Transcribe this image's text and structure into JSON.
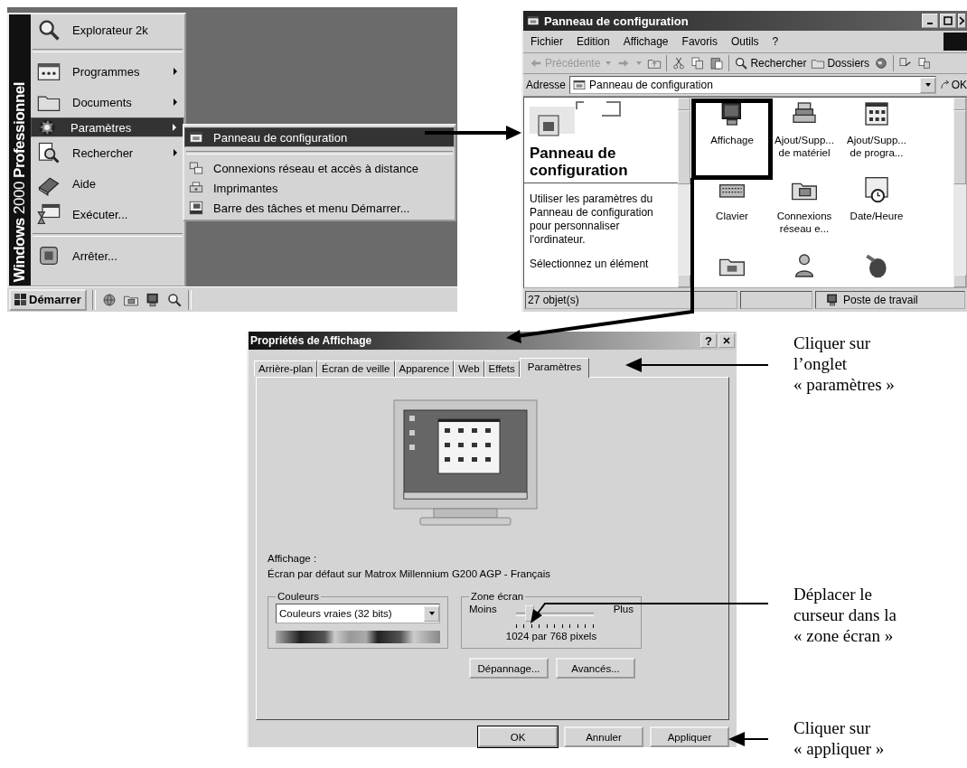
{
  "start_menu": {
    "banner": "**Windows** 2000 **Professionnel**",
    "groups": [
      [
        {
          "label": "Explorateur 2k",
          "has_submenu": false,
          "selected": false
        }
      ],
      [
        {
          "label": "Programmes",
          "has_submenu": true,
          "selected": false
        },
        {
          "label": "Documents",
          "has_submenu": true,
          "selected": false
        },
        {
          "label": "Paramètres",
          "has_submenu": true,
          "selected": true
        },
        {
          "label": "Rechercher",
          "has_submenu": true,
          "selected": false
        },
        {
          "label": "Aide",
          "has_submenu": false,
          "selected": false
        },
        {
          "label": "Exécuter...",
          "has_submenu": false,
          "selected": false
        }
      ],
      [
        {
          "label": "Arrêter...",
          "has_submenu": false,
          "selected": false
        }
      ]
    ],
    "submenu": {
      "groups": [
        [
          {
            "label": "Panneau de configuration",
            "selected": true
          }
        ],
        [
          {
            "label": "Connexions réseau et accès à distance",
            "selected": false
          },
          {
            "label": "Imprimantes",
            "selected": false
          },
          {
            "label": "Barre des tâches et menu Démarrer...",
            "selected": false
          }
        ]
      ]
    }
  },
  "taskbar": {
    "start_button": "Démarrer"
  },
  "control_panel": {
    "title": "Panneau de configuration",
    "menu": [
      "Fichier",
      "Edition",
      "Affichage",
      "Favoris",
      "Outils",
      "?"
    ],
    "toolbar": {
      "back": {
        "label": "Précédente",
        "disabled": true
      },
      "search": "Rechercher",
      "folders": "Dossiers"
    },
    "address": {
      "label": "Adresse",
      "value": "Panneau de configuration",
      "go": "OK"
    },
    "sidebar": {
      "heading": "Panneau de configuration",
      "paragraphs": [
        "Utiliser les paramètres du Panneau de configuration pour personnaliser l'ordinateur.",
        "Sélectionnez un élément"
      ]
    },
    "items": [
      {
        "label": "Affichage",
        "highlighted": true
      },
      {
        "label": "Ajout/Supp... de matériel",
        "highlighted": false
      },
      {
        "label": "Ajout/Supp... de progra...",
        "highlighted": false
      },
      {
        "label": "Clavier",
        "highlighted": false
      },
      {
        "label": "Connexions réseau e...",
        "highlighted": false
      },
      {
        "label": "Date/Heure",
        "highlighted": false
      },
      {
        "highlighted": false
      },
      {
        "highlighted": false
      },
      {
        "highlighted": false
      }
    ],
    "status_bar": {
      "count": "27 objet(s)",
      "location": "Poste de travail"
    }
  },
  "dialog": {
    "title": "Propriétés de Affichage",
    "help": "?",
    "tabs": [
      {
        "label": "Arrière-plan",
        "selected": false
      },
      {
        "label": "Écran de veille",
        "selected": false
      },
      {
        "label": "Apparence",
        "selected": false
      },
      {
        "label": "Web",
        "selected": false
      },
      {
        "label": "Effets",
        "selected": false
      },
      {
        "label": "Paramètres",
        "selected": true
      }
    ],
    "display_label": "Affichage :",
    "display_value": "Écran par défaut sur Matrox Millennium G200 AGP - Français",
    "colors": {
      "legend": "Couleurs",
      "value": "Couleurs vraies (32 bits)"
    },
    "screen_area": {
      "legend": "Zone écran",
      "min": "Moins",
      "max": "Plus",
      "level": 0.17,
      "reading": "1024 par 768 pixels"
    },
    "buttons": [
      "Dépannage...",
      "Avancés..."
    ],
    "footer_buttons": [
      "OK",
      "Annuler",
      "Appliquer"
    ]
  },
  "annotations": [
    "Cliquer sur\nl’onglet\n« paramètres »",
    "Déplacer le\ncurseur dans la\n« zone écran »",
    "Cliquer sur\n« appliquer »"
  ]
}
